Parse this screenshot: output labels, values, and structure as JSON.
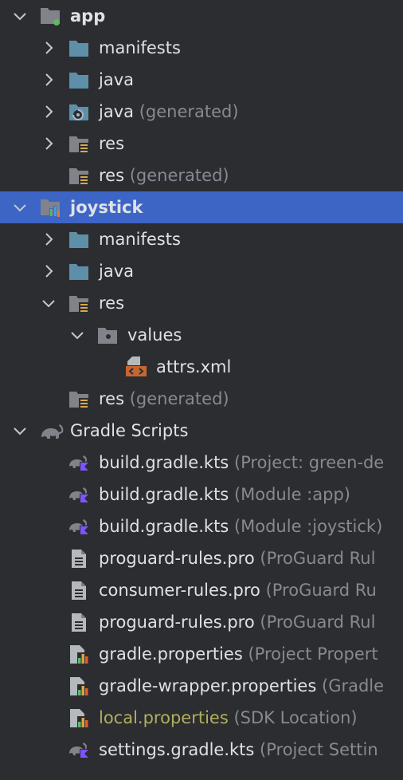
{
  "tree": [
    {
      "id": "app",
      "label": "app",
      "hint": "",
      "level": 0,
      "chevron": "down",
      "icon": "module-app-icon",
      "style": "bold"
    },
    {
      "id": "app-manifests",
      "label": "manifests",
      "hint": "",
      "level": 1,
      "chevron": "right",
      "icon": "folder-icon",
      "style": ""
    },
    {
      "id": "app-java",
      "label": "java",
      "hint": "",
      "level": 1,
      "chevron": "right",
      "icon": "folder-icon",
      "style": ""
    },
    {
      "id": "app-java-generated",
      "label": "java",
      "hint": "(generated)",
      "level": 1,
      "chevron": "right",
      "icon": "generated-folder-icon",
      "style": ""
    },
    {
      "id": "app-res",
      "label": "res",
      "hint": "",
      "level": 1,
      "chevron": "right",
      "icon": "res-folder-icon",
      "style": ""
    },
    {
      "id": "app-res-generated",
      "label": "res",
      "hint": "(generated)",
      "level": 1,
      "chevron": "none",
      "icon": "res-folder-icon",
      "style": ""
    },
    {
      "id": "joystick",
      "label": "joystick",
      "hint": "",
      "level": 0,
      "chevron": "down",
      "icon": "module-library-icon",
      "style": "bold",
      "selected": true
    },
    {
      "id": "joy-manifests",
      "label": "manifests",
      "hint": "",
      "level": 1,
      "chevron": "right",
      "icon": "folder-icon",
      "style": ""
    },
    {
      "id": "joy-java",
      "label": "java",
      "hint": "",
      "level": 1,
      "chevron": "right",
      "icon": "folder-icon",
      "style": ""
    },
    {
      "id": "joy-res",
      "label": "res",
      "hint": "",
      "level": 1,
      "chevron": "down",
      "icon": "res-folder-icon",
      "style": ""
    },
    {
      "id": "joy-values",
      "label": "values",
      "hint": "",
      "level": 2,
      "chevron": "down",
      "icon": "values-folder-icon",
      "style": ""
    },
    {
      "id": "joy-attrs",
      "label": "attrs.xml",
      "hint": "",
      "level": 3,
      "chevron": "none",
      "icon": "xml-file-icon",
      "style": ""
    },
    {
      "id": "joy-res-generated",
      "label": "res",
      "hint": "(generated)",
      "level": 1,
      "chevron": "none",
      "icon": "res-folder-icon",
      "style": ""
    },
    {
      "id": "gradle-scripts",
      "label": "Gradle Scripts",
      "hint": "",
      "level": 0,
      "chevron": "down",
      "icon": "gradle-elephant-icon",
      "style": ""
    },
    {
      "id": "gs-build-project",
      "label": "build.gradle.kts",
      "hint": "(Project: green-de",
      "level": 1,
      "chevron": "none",
      "icon": "gradle-kts-icon",
      "style": ""
    },
    {
      "id": "gs-build-app",
      "label": "build.gradle.kts",
      "hint": "(Module :app)",
      "level": 1,
      "chevron": "none",
      "icon": "gradle-kts-icon",
      "style": ""
    },
    {
      "id": "gs-build-joystick",
      "label": "build.gradle.kts",
      "hint": "(Module :joystick)",
      "level": 1,
      "chevron": "none",
      "icon": "gradle-kts-icon",
      "style": ""
    },
    {
      "id": "gs-proguard-app",
      "label": "proguard-rules.pro",
      "hint": "(ProGuard Rul",
      "level": 1,
      "chevron": "none",
      "icon": "text-file-icon",
      "style": ""
    },
    {
      "id": "gs-consumer",
      "label": "consumer-rules.pro",
      "hint": "(ProGuard Ru",
      "level": 1,
      "chevron": "none",
      "icon": "text-file-icon",
      "style": ""
    },
    {
      "id": "gs-proguard-joy",
      "label": "proguard-rules.pro",
      "hint": "(ProGuard Rul",
      "level": 1,
      "chevron": "none",
      "icon": "text-file-icon",
      "style": ""
    },
    {
      "id": "gs-gradle-props",
      "label": "gradle.properties",
      "hint": "(Project Propert",
      "level": 1,
      "chevron": "none",
      "icon": "properties-file-icon",
      "style": ""
    },
    {
      "id": "gs-wrapper-props",
      "label": "gradle-wrapper.properties",
      "hint": "(Gradle",
      "level": 1,
      "chevron": "none",
      "icon": "properties-file-icon",
      "style": ""
    },
    {
      "id": "gs-local-props",
      "label": "local.properties",
      "hint": "(SDK Location)",
      "level": 1,
      "chevron": "none",
      "icon": "properties-file-icon",
      "style": "yellow"
    },
    {
      "id": "gs-settings",
      "label": "settings.gradle.kts",
      "hint": "(Project Settin",
      "level": 1,
      "chevron": "none",
      "icon": "gradle-kts-icon",
      "style": ""
    }
  ]
}
